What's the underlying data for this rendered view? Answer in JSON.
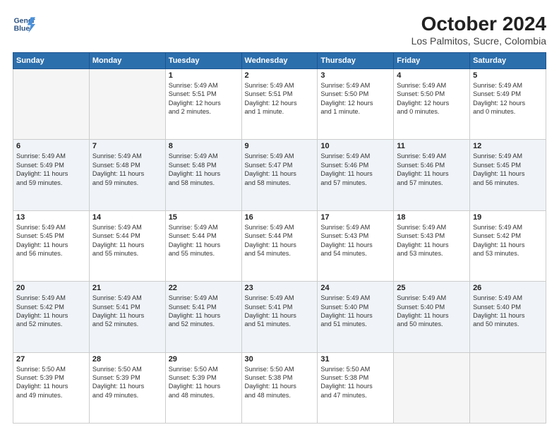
{
  "logo": {
    "line1": "General",
    "line2": "Blue"
  },
  "title": "October 2024",
  "location": "Los Palmitos, Sucre, Colombia",
  "days_of_week": [
    "Sunday",
    "Monday",
    "Tuesday",
    "Wednesday",
    "Thursday",
    "Friday",
    "Saturday"
  ],
  "weeks": [
    [
      {
        "day": "",
        "info": ""
      },
      {
        "day": "",
        "info": ""
      },
      {
        "day": "1",
        "info": "Sunrise: 5:49 AM\nSunset: 5:51 PM\nDaylight: 12 hours\nand 2 minutes."
      },
      {
        "day": "2",
        "info": "Sunrise: 5:49 AM\nSunset: 5:51 PM\nDaylight: 12 hours\nand 1 minute."
      },
      {
        "day": "3",
        "info": "Sunrise: 5:49 AM\nSunset: 5:50 PM\nDaylight: 12 hours\nand 1 minute."
      },
      {
        "day": "4",
        "info": "Sunrise: 5:49 AM\nSunset: 5:50 PM\nDaylight: 12 hours\nand 0 minutes."
      },
      {
        "day": "5",
        "info": "Sunrise: 5:49 AM\nSunset: 5:49 PM\nDaylight: 12 hours\nand 0 minutes."
      }
    ],
    [
      {
        "day": "6",
        "info": "Sunrise: 5:49 AM\nSunset: 5:49 PM\nDaylight: 11 hours\nand 59 minutes."
      },
      {
        "day": "7",
        "info": "Sunrise: 5:49 AM\nSunset: 5:48 PM\nDaylight: 11 hours\nand 59 minutes."
      },
      {
        "day": "8",
        "info": "Sunrise: 5:49 AM\nSunset: 5:48 PM\nDaylight: 11 hours\nand 58 minutes."
      },
      {
        "day": "9",
        "info": "Sunrise: 5:49 AM\nSunset: 5:47 PM\nDaylight: 11 hours\nand 58 minutes."
      },
      {
        "day": "10",
        "info": "Sunrise: 5:49 AM\nSunset: 5:46 PM\nDaylight: 11 hours\nand 57 minutes."
      },
      {
        "day": "11",
        "info": "Sunrise: 5:49 AM\nSunset: 5:46 PM\nDaylight: 11 hours\nand 57 minutes."
      },
      {
        "day": "12",
        "info": "Sunrise: 5:49 AM\nSunset: 5:45 PM\nDaylight: 11 hours\nand 56 minutes."
      }
    ],
    [
      {
        "day": "13",
        "info": "Sunrise: 5:49 AM\nSunset: 5:45 PM\nDaylight: 11 hours\nand 56 minutes."
      },
      {
        "day": "14",
        "info": "Sunrise: 5:49 AM\nSunset: 5:44 PM\nDaylight: 11 hours\nand 55 minutes."
      },
      {
        "day": "15",
        "info": "Sunrise: 5:49 AM\nSunset: 5:44 PM\nDaylight: 11 hours\nand 55 minutes."
      },
      {
        "day": "16",
        "info": "Sunrise: 5:49 AM\nSunset: 5:44 PM\nDaylight: 11 hours\nand 54 minutes."
      },
      {
        "day": "17",
        "info": "Sunrise: 5:49 AM\nSunset: 5:43 PM\nDaylight: 11 hours\nand 54 minutes."
      },
      {
        "day": "18",
        "info": "Sunrise: 5:49 AM\nSunset: 5:43 PM\nDaylight: 11 hours\nand 53 minutes."
      },
      {
        "day": "19",
        "info": "Sunrise: 5:49 AM\nSunset: 5:42 PM\nDaylight: 11 hours\nand 53 minutes."
      }
    ],
    [
      {
        "day": "20",
        "info": "Sunrise: 5:49 AM\nSunset: 5:42 PM\nDaylight: 11 hours\nand 52 minutes."
      },
      {
        "day": "21",
        "info": "Sunrise: 5:49 AM\nSunset: 5:41 PM\nDaylight: 11 hours\nand 52 minutes."
      },
      {
        "day": "22",
        "info": "Sunrise: 5:49 AM\nSunset: 5:41 PM\nDaylight: 11 hours\nand 52 minutes."
      },
      {
        "day": "23",
        "info": "Sunrise: 5:49 AM\nSunset: 5:41 PM\nDaylight: 11 hours\nand 51 minutes."
      },
      {
        "day": "24",
        "info": "Sunrise: 5:49 AM\nSunset: 5:40 PM\nDaylight: 11 hours\nand 51 minutes."
      },
      {
        "day": "25",
        "info": "Sunrise: 5:49 AM\nSunset: 5:40 PM\nDaylight: 11 hours\nand 50 minutes."
      },
      {
        "day": "26",
        "info": "Sunrise: 5:49 AM\nSunset: 5:40 PM\nDaylight: 11 hours\nand 50 minutes."
      }
    ],
    [
      {
        "day": "27",
        "info": "Sunrise: 5:50 AM\nSunset: 5:39 PM\nDaylight: 11 hours\nand 49 minutes."
      },
      {
        "day": "28",
        "info": "Sunrise: 5:50 AM\nSunset: 5:39 PM\nDaylight: 11 hours\nand 49 minutes."
      },
      {
        "day": "29",
        "info": "Sunrise: 5:50 AM\nSunset: 5:39 PM\nDaylight: 11 hours\nand 48 minutes."
      },
      {
        "day": "30",
        "info": "Sunrise: 5:50 AM\nSunset: 5:38 PM\nDaylight: 11 hours\nand 48 minutes."
      },
      {
        "day": "31",
        "info": "Sunrise: 5:50 AM\nSunset: 5:38 PM\nDaylight: 11 hours\nand 47 minutes."
      },
      {
        "day": "",
        "info": ""
      },
      {
        "day": "",
        "info": ""
      }
    ]
  ]
}
